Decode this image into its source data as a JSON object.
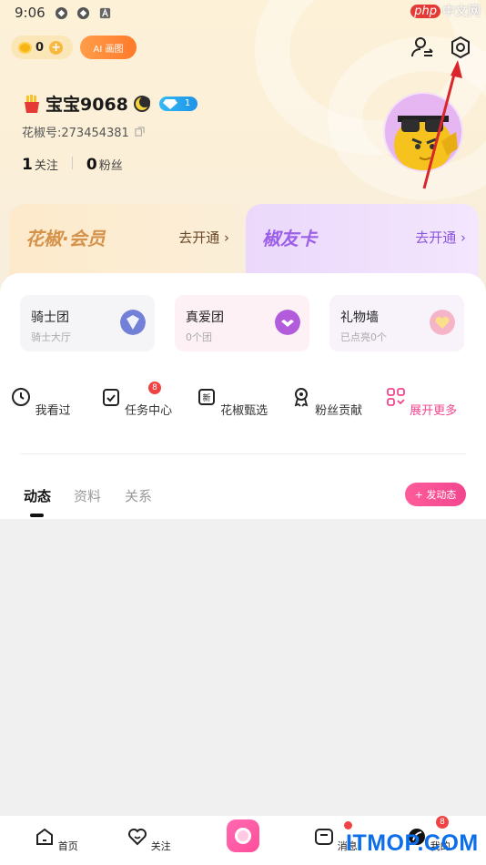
{
  "status_bar": {
    "time": "9:06",
    "watermark_badge": "php",
    "watermark_text": "中文网"
  },
  "header": {
    "coins": "0",
    "ai_label": "AI 画图"
  },
  "profile": {
    "name": "宝宝9068",
    "vip_level": "1",
    "id_label": "花椒号:273454381",
    "following_count": "1",
    "following_label": "关注",
    "fans_count": "0",
    "fans_label": "粉丝"
  },
  "promo": {
    "vip_title": "花椒·会员",
    "vip_action": "去开通",
    "card_title": "椒友卡",
    "card_action": "去开通"
  },
  "features": [
    {
      "title": "骑士团",
      "subtitle": "骑士大厅",
      "color": "#6f7fd8"
    },
    {
      "title": "真爱团",
      "subtitle": "0个团",
      "color": "#b05bdc"
    },
    {
      "title": "礼物墙",
      "subtitle": "已点亮0个",
      "color": "#f3a0bf"
    }
  ],
  "tools": [
    {
      "label": "我看过"
    },
    {
      "label": "任务中心",
      "badge": "8"
    },
    {
      "label": "花椒甄选"
    },
    {
      "label": "粉丝贡献"
    },
    {
      "label": "展开更多"
    }
  ],
  "tabs": {
    "feed": "动态",
    "info": "资料",
    "relations": "关系",
    "post_button": "+ 发动态"
  },
  "bottom_nav": {
    "home": "首页",
    "follow": "关注",
    "messages": "消息",
    "me": "我的",
    "me_badge": "8"
  },
  "watermark_bottom": "ITMOP.COM",
  "colors": {
    "accent_pink": "#f2468f",
    "brand_orange": "#ff7a2a",
    "annotation_red": "#d9262c"
  }
}
